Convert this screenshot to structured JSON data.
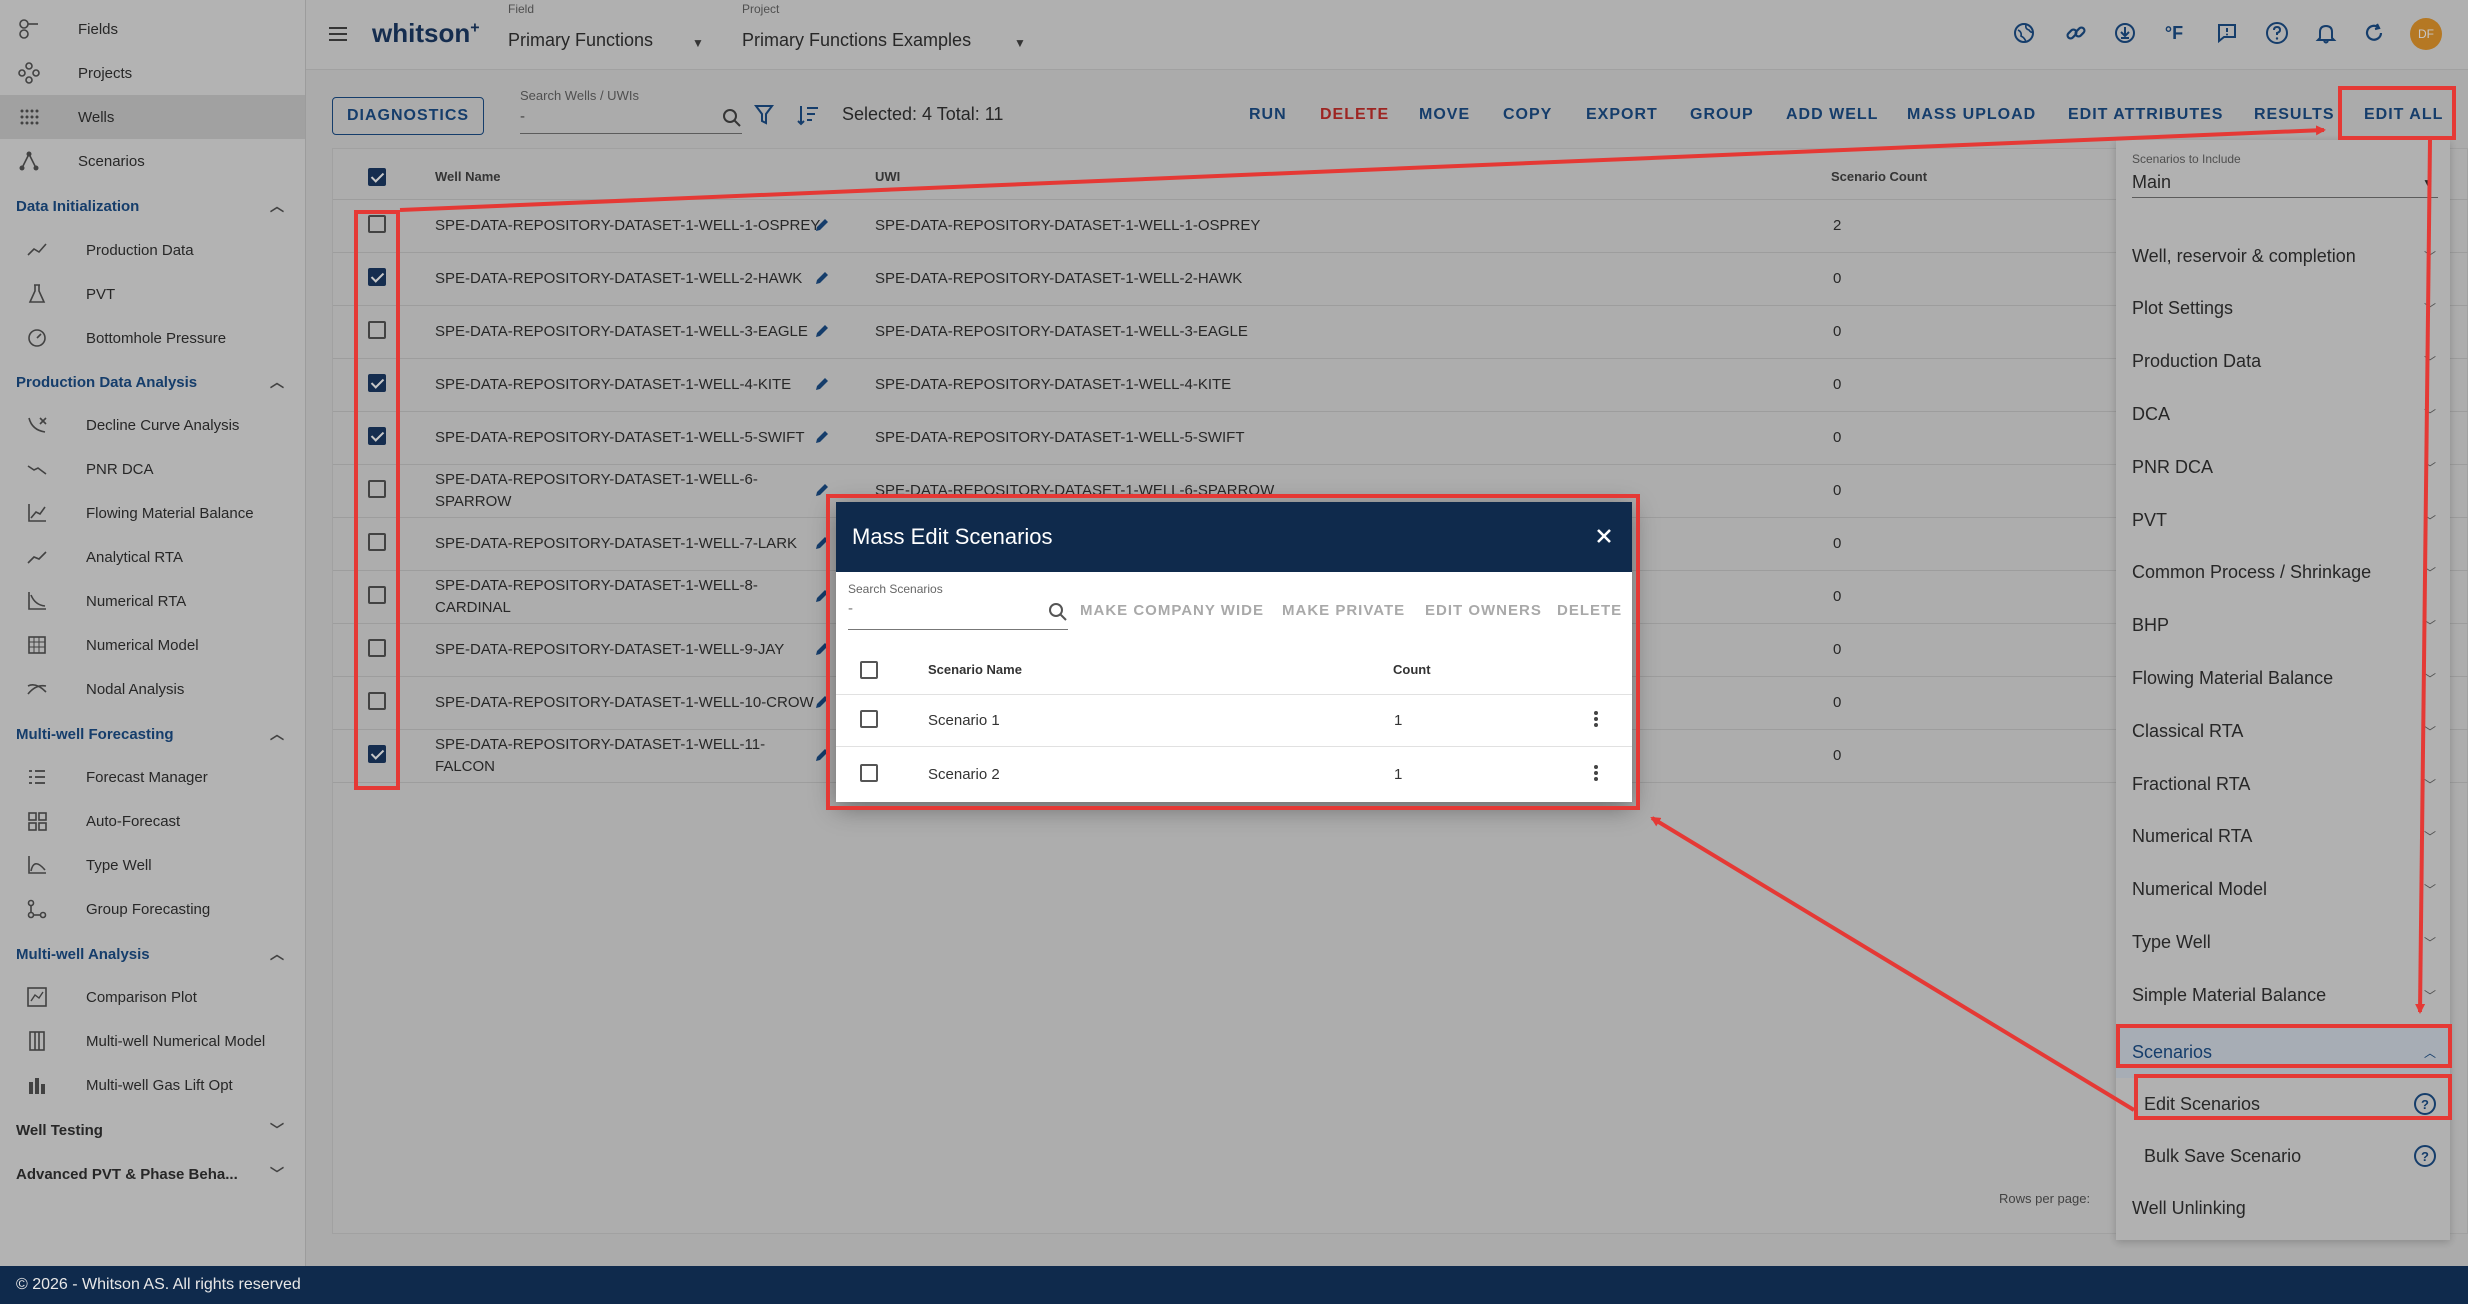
{
  "sidebar": {
    "top_items": [
      {
        "label": "Fields",
        "icon": "fields-icon"
      },
      {
        "label": "Projects",
        "icon": "projects-icon"
      },
      {
        "label": "Wells",
        "icon": "wells-icon"
      },
      {
        "label": "Scenarios",
        "icon": "scenarios-icon"
      }
    ],
    "sections": [
      {
        "title": "Data Initialization",
        "items": [
          "Production Data",
          "PVT",
          "Bottomhole Pressure"
        ]
      },
      {
        "title": "Production Data Analysis",
        "items": [
          "Decline Curve Analysis",
          "PNR DCA",
          "Flowing Material Balance",
          "Analytical RTA",
          "Numerical RTA",
          "Numerical Model",
          "Nodal Analysis"
        ]
      },
      {
        "title": "Multi-well Forecasting",
        "items": [
          "Forecast Manager",
          "Auto-Forecast",
          "Type Well",
          "Group Forecasting"
        ]
      },
      {
        "title": "Multi-well Analysis",
        "items": [
          "Comparison Plot",
          "Multi-well Numerical Model",
          "Multi-well Gas Lift Opt"
        ]
      },
      {
        "title": "Well Testing",
        "items": []
      },
      {
        "title": "Advanced PVT & Phase Beha...",
        "items": []
      }
    ]
  },
  "footer": {
    "text": "© 2026 - Whitson AS. All rights reserved"
  },
  "topbar": {
    "brand": "whitson",
    "brand_sup": "+",
    "field_caption": "Field",
    "field_value": "Primary Functions",
    "project_caption": "Project",
    "project_value": "Primary Functions Examples",
    "units_label": "°F",
    "avatar_initials": "DF"
  },
  "toolbar": {
    "diagnostics": "DIAGNOSTICS",
    "search_caption": "Search Wells / UWIs",
    "search_value": "-",
    "selected_text": "Selected: 4 Total: 11",
    "actions": [
      "RUN",
      "DELETE",
      "MOVE",
      "COPY",
      "EXPORT",
      "GROUP",
      "ADD WELL",
      "MASS UPLOAD",
      "EDIT ATTRIBUTES",
      "RESULTS",
      "EDIT ALL"
    ]
  },
  "table": {
    "headers": {
      "well_name": "Well Name",
      "uwi": "UWI",
      "scenario_count": "Scenario Count"
    },
    "rows": [
      {
        "name1": "SPE-DATA-REPOSITORY-DATASET-1-WELL-1-OSPREY",
        "name2": "",
        "uwi": "SPE-DATA-REPOSITORY-DATASET-1-WELL-1-OSPREY",
        "count": "2",
        "checked": false
      },
      {
        "name1": "SPE-DATA-REPOSITORY-DATASET-1-WELL-2-HAWK",
        "name2": "",
        "uwi": "SPE-DATA-REPOSITORY-DATASET-1-WELL-2-HAWK",
        "count": "0",
        "checked": true
      },
      {
        "name1": "SPE-DATA-REPOSITORY-DATASET-1-WELL-3-EAGLE",
        "name2": "",
        "uwi": "SPE-DATA-REPOSITORY-DATASET-1-WELL-3-EAGLE",
        "count": "0",
        "checked": false
      },
      {
        "name1": "SPE-DATA-REPOSITORY-DATASET-1-WELL-4-KITE",
        "name2": "",
        "uwi": "SPE-DATA-REPOSITORY-DATASET-1-WELL-4-KITE",
        "count": "0",
        "checked": true
      },
      {
        "name1": "SPE-DATA-REPOSITORY-DATASET-1-WELL-5-SWIFT",
        "name2": "",
        "uwi": "SPE-DATA-REPOSITORY-DATASET-1-WELL-5-SWIFT",
        "count": "0",
        "checked": true
      },
      {
        "name1": "SPE-DATA-REPOSITORY-DATASET-1-WELL-6-",
        "name2": "SPARROW",
        "uwi": "SPE-DATA-REPOSITORY-DATASET-1-WELL-6-SPARROW",
        "count": "0",
        "checked": false
      },
      {
        "name1": "SPE-DATA-REPOSITORY-DATASET-1-WELL-7-LARK",
        "name2": "",
        "uwi": "",
        "count": "0",
        "checked": false
      },
      {
        "name1": "SPE-DATA-REPOSITORY-DATASET-1-WELL-8-",
        "name2": "CARDINAL",
        "uwi": "",
        "count": "0",
        "checked": false
      },
      {
        "name1": "SPE-DATA-REPOSITORY-DATASET-1-WELL-9-JAY",
        "name2": "",
        "uwi": "",
        "count": "0",
        "checked": false
      },
      {
        "name1": "SPE-DATA-REPOSITORY-DATASET-1-WELL-10-CROW",
        "name2": "",
        "uwi": "",
        "count": "0",
        "checked": false
      },
      {
        "name1": "SPE-DATA-REPOSITORY-DATASET-1-WELL-11-",
        "name2": "FALCON",
        "uwi": "",
        "count": "0",
        "checked": true
      }
    ],
    "rows_per_page": "Rows per page:"
  },
  "right_panel": {
    "scenarios_caption": "Scenarios to Include",
    "scenarios_value": "Main",
    "items": [
      "Well, reservoir & completion",
      "Plot Settings",
      "Production Data",
      "DCA",
      "PNR DCA",
      "PVT",
      "Common Process / Shrinkage",
      "BHP",
      "Flowing Material Balance",
      "Classical RTA",
      "Fractional RTA",
      "Numerical RTA",
      "Numerical Model",
      "Type Well",
      "Simple Material Balance"
    ],
    "scenarios_section": "Scenarios",
    "edit_scenarios": "Edit Scenarios",
    "bulk_save": "Bulk Save Scenario",
    "well_unlinking": "Well Unlinking",
    "help_glyph": "?"
  },
  "modal": {
    "title": "Mass Edit Scenarios",
    "search_caption": "Search Scenarios",
    "search_value": "-",
    "actions": [
      "MAKE COMPANY WIDE",
      "MAKE PRIVATE",
      "EDIT OWNERS",
      "DELETE"
    ],
    "headers": {
      "name": "Scenario Name",
      "count": "Count"
    },
    "rows": [
      {
        "name": "Scenario 1",
        "count": "1"
      },
      {
        "name": "Scenario 2",
        "count": "1"
      }
    ]
  },
  "colors": {
    "primary": "#1c4f8a",
    "header_navy": "#0f2a4c",
    "annotation_red": "#e53935",
    "danger": "#c9302c",
    "avatar": "#e89a2e"
  }
}
